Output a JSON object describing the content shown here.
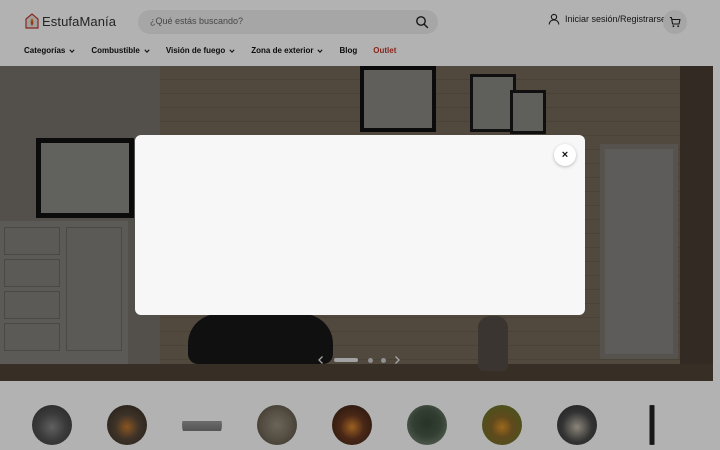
{
  "brand": {
    "name": "EstufaManía",
    "accent": "#c0392b"
  },
  "search": {
    "placeholder": "¿Qué estás buscando?",
    "icon": "search-icon"
  },
  "account": {
    "login_label": "Iniciar sesión/Registrarse",
    "icon": "user-icon"
  },
  "cart": {
    "icon": "cart-icon"
  },
  "nav": {
    "items": [
      {
        "label": "Categorías",
        "has_dropdown": true
      },
      {
        "label": "Combustible",
        "has_dropdown": true
      },
      {
        "label": "Visión de fuego",
        "has_dropdown": true
      },
      {
        "label": "Zona de exterior",
        "has_dropdown": true
      },
      {
        "label": "Blog",
        "has_dropdown": false
      },
      {
        "label": "Outlet",
        "has_dropdown": false,
        "color": "#c0392b"
      }
    ]
  },
  "hero": {
    "carousel": {
      "slide_count": 3,
      "active_index": 0
    }
  },
  "categories": {
    "items": [
      {
        "icon": "stove-category-icon",
        "color": "#555555"
      },
      {
        "icon": "fire-pit-category-icon",
        "color": "#5a4a3a"
      },
      {
        "icon": "bioethanol-burner-category-icon",
        "color": "#9a9a9a"
      },
      {
        "icon": "patio-heater-category-icon",
        "color": "#7a7060"
      },
      {
        "icon": "outdoor-fireplace-category-icon",
        "color": "#6b3a22"
      },
      {
        "icon": "kamado-grill-category-icon",
        "color": "#4a5a4a"
      },
      {
        "icon": "fire-bowl-category-icon",
        "color": "#6a7a3a"
      },
      {
        "icon": "gas-fire-table-category-icon",
        "color": "#4a4a4a"
      },
      {
        "icon": "tower-heater-category-icon",
        "color": "#222222"
      }
    ]
  },
  "modal": {
    "close_label": "×"
  }
}
